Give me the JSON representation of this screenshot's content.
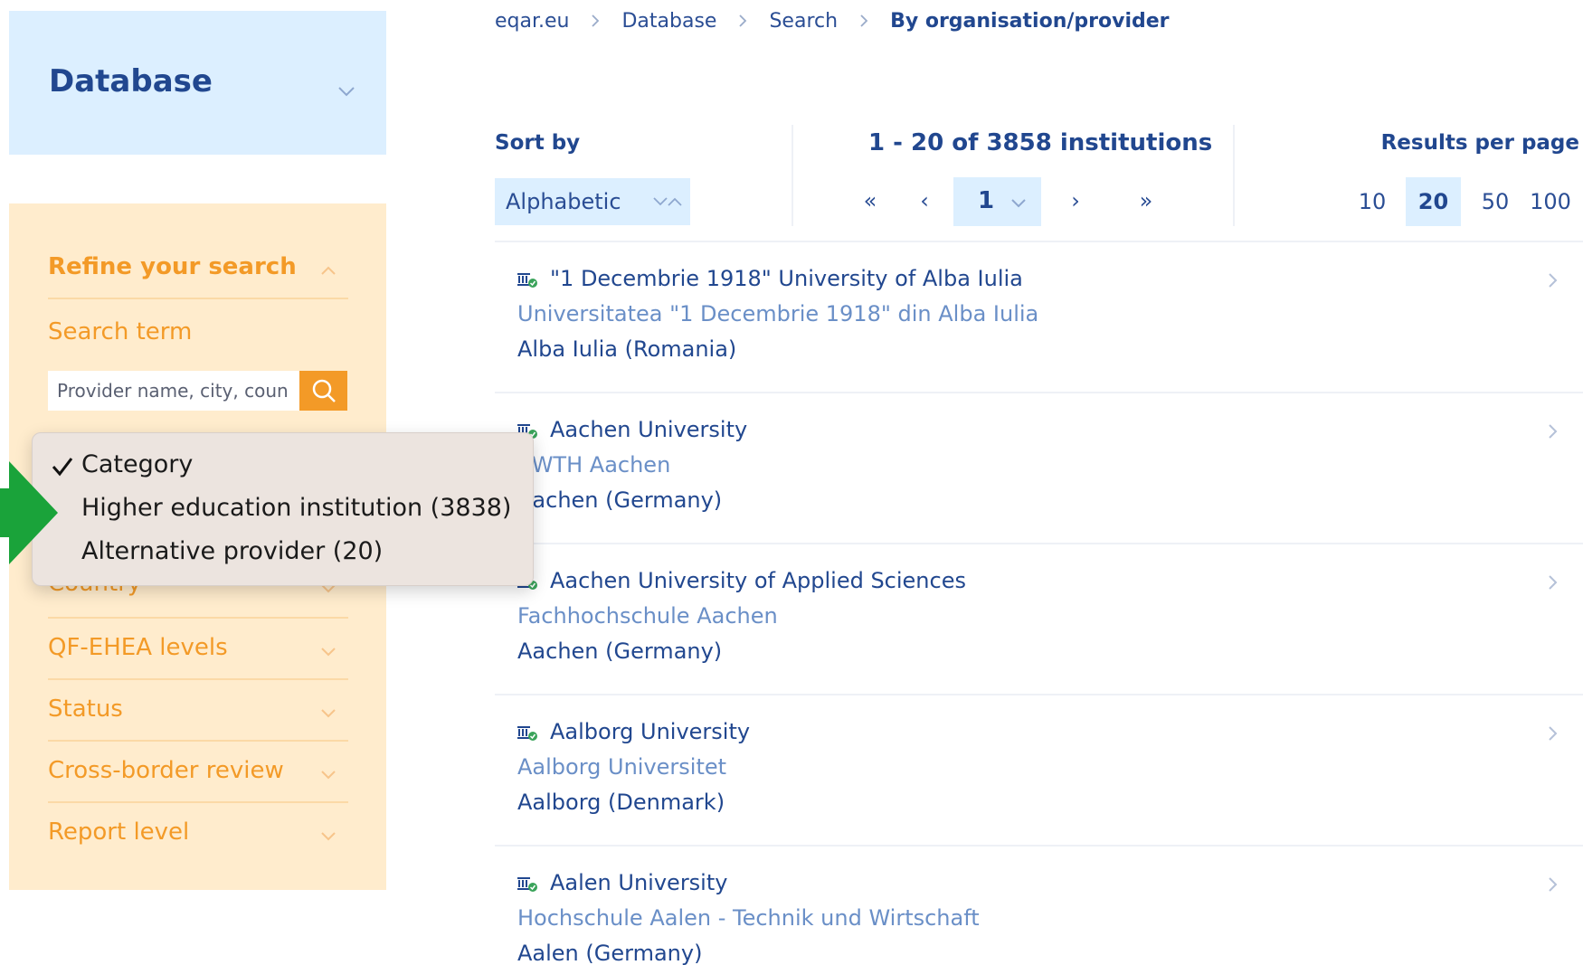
{
  "sidebar": {
    "database_title": "Database",
    "refine_title": "Refine your search",
    "search_term_label": "Search term",
    "search_placeholder": "Provider name, city, coun",
    "filters": [
      {
        "label": "Country"
      },
      {
        "label": "QF-EHEA levels"
      },
      {
        "label": "Status"
      },
      {
        "label": "Cross-border review"
      },
      {
        "label": "Report level"
      }
    ]
  },
  "category_popup": {
    "options": [
      {
        "label": "Category",
        "checked": true
      },
      {
        "label": "Higher education institution (3838)",
        "checked": false
      },
      {
        "label": "Alternative provider (20)",
        "checked": false
      }
    ]
  },
  "breadcrumb": {
    "items": [
      "eqar.eu",
      "Database",
      "Search"
    ],
    "current": "By organisation/provider"
  },
  "controls": {
    "sort_label": "Sort by",
    "sort_value": "Alphabetic",
    "count_text": "1 - 20 of 3858 institutions",
    "pagination": {
      "first": "«",
      "prev": "‹",
      "current_page": "1",
      "next": "›",
      "last": "»"
    },
    "results_per_page_label": "Results per page",
    "results_per_page_options": [
      "10",
      "20",
      "50",
      "100"
    ],
    "results_per_page_selected": "20"
  },
  "results": [
    {
      "name": "\"1 Decembrie 1918\" University of Alba Iulia",
      "local_name": "Universitatea \"1 Decembrie 1918\" din Alba Iulia",
      "location": "Alba Iulia (Romania)"
    },
    {
      "name": "Aachen University",
      "local_name": "RWTH Aachen",
      "location": "Aachen (Germany)"
    },
    {
      "name": "Aachen University of Applied Sciences",
      "local_name": "Fachhochschule Aachen",
      "location": "Aachen (Germany)"
    },
    {
      "name": "Aalborg University",
      "local_name": "Aalborg Universitet",
      "location": "Aalborg (Denmark)"
    },
    {
      "name": "Aalen University",
      "local_name": "Hochschule Aalen - Technik und Wirtschaft",
      "location": "Aalen (Germany)"
    }
  ],
  "colors": {
    "navy": "#21478f",
    "orange": "#f39a27",
    "light_blue": "#dcefff",
    "cream": "#ffeccd",
    "annotation_arrow": "#1aa33a"
  }
}
